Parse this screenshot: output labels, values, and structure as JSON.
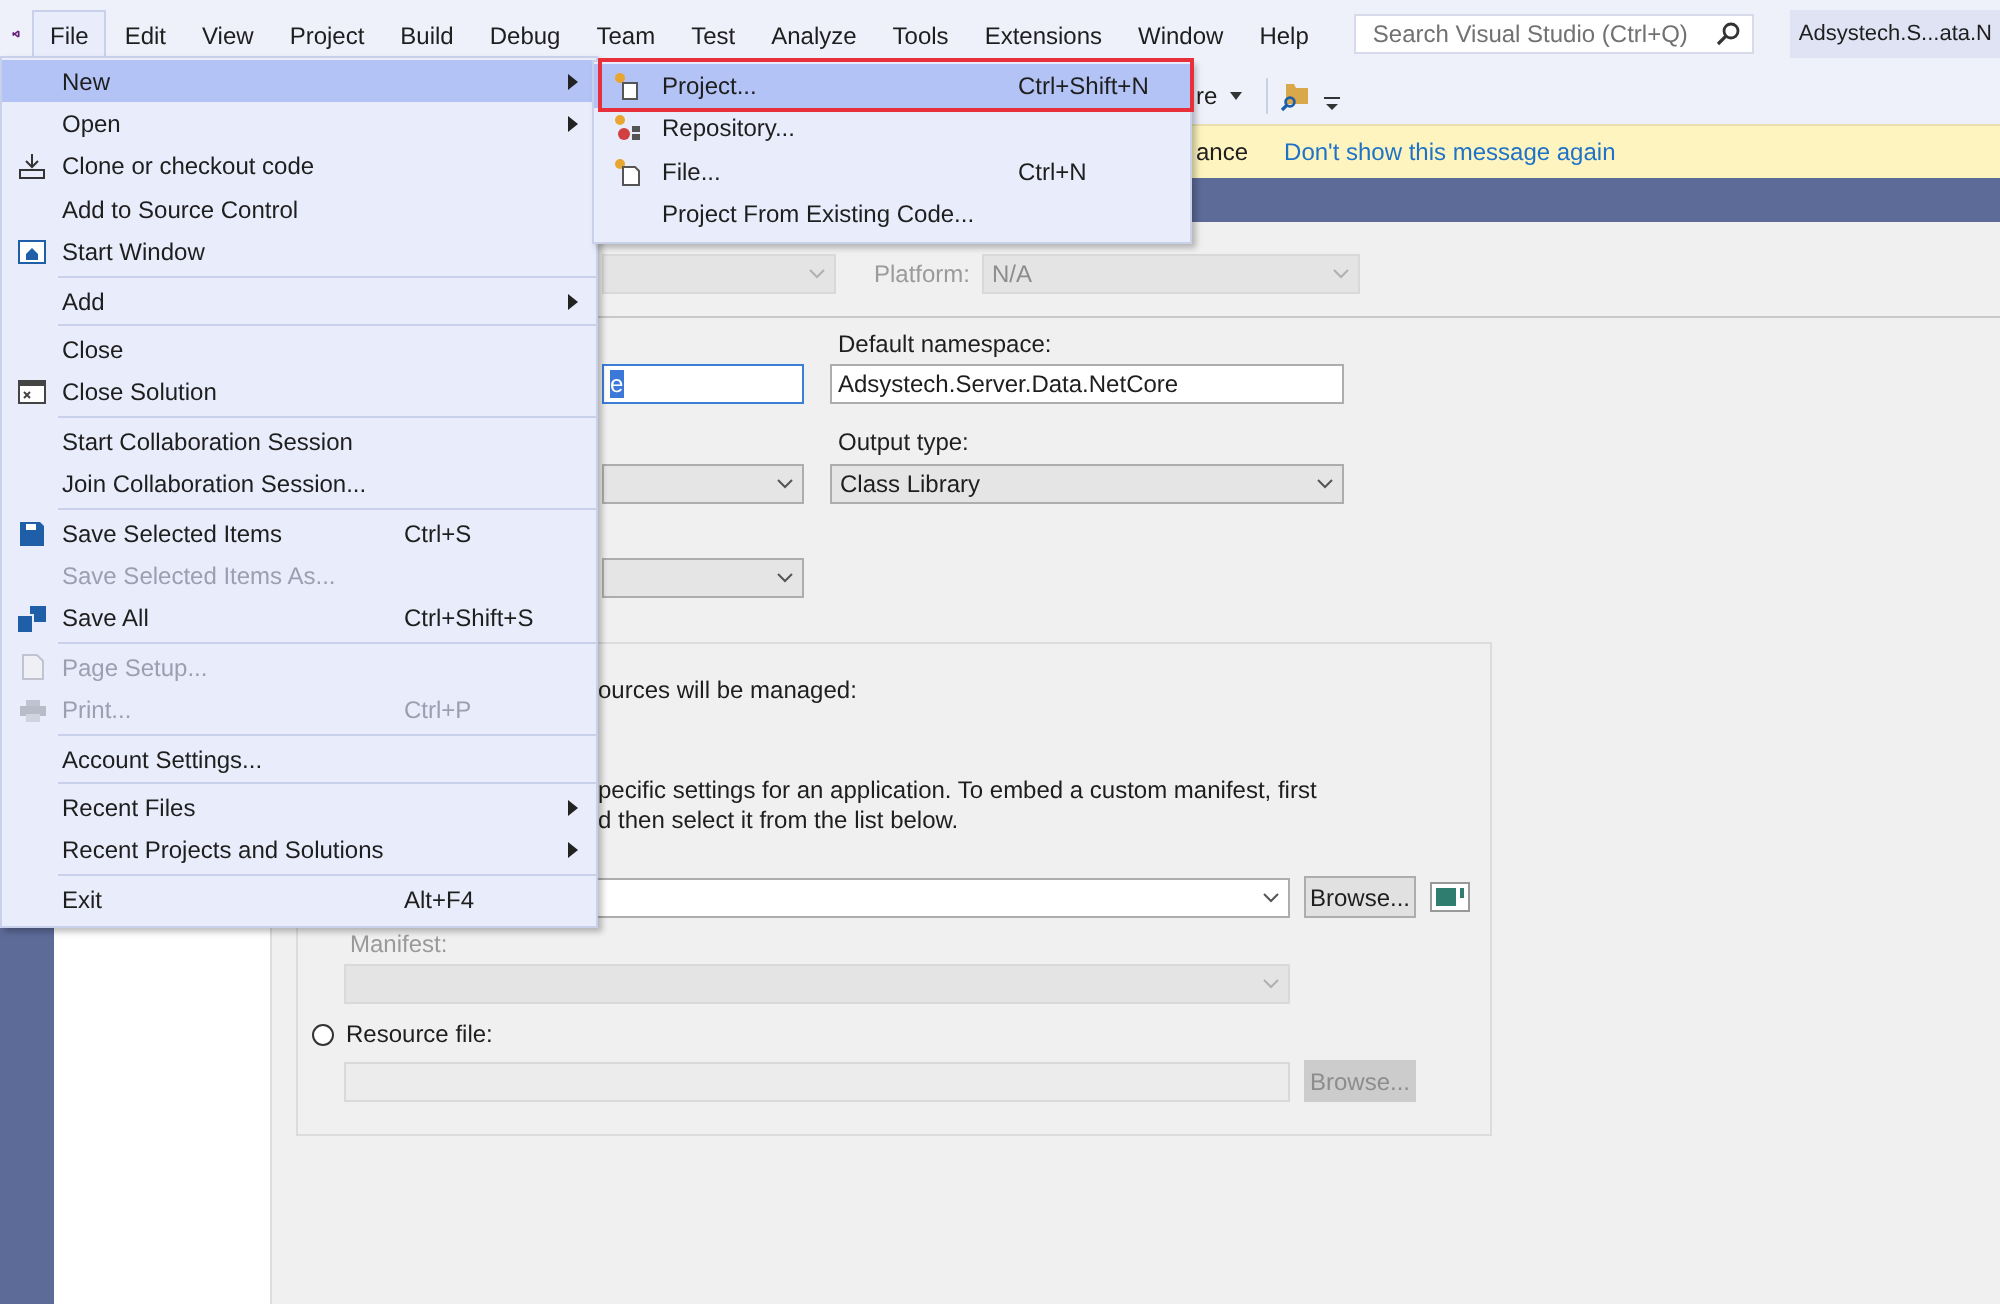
{
  "menubar": {
    "items": [
      {
        "label": "File",
        "selected": true
      },
      {
        "label": "Edit",
        "selected": false
      },
      {
        "label": "View",
        "selected": false
      },
      {
        "label": "Project",
        "selected": false
      },
      {
        "label": "Build",
        "selected": false
      },
      {
        "label": "Debug",
        "selected": false
      },
      {
        "label": "Team",
        "selected": false
      },
      {
        "label": "Test",
        "selected": false
      },
      {
        "label": "Analyze",
        "selected": false
      },
      {
        "label": "Tools",
        "selected": false
      },
      {
        "label": "Extensions",
        "selected": false
      },
      {
        "label": "Window",
        "selected": false
      },
      {
        "label": "Help",
        "selected": false
      }
    ],
    "search": {
      "placeholder": "Search Visual Studio (Ctrl+Q)"
    },
    "solution_title": "Adsystech.S...ata.N"
  },
  "toolbar": {
    "dropdown_text": "re"
  },
  "info_bar": {
    "text": "ance",
    "link": "Don't show this message again"
  },
  "properties": {
    "platform_label": "Platform:",
    "platform_value": "N/A",
    "left_input_value": "e",
    "namespace_label": "Default namespace:",
    "namespace_value": "Adsystech.Server.Data.NetCore",
    "output_label": "Output type:",
    "output_value": "Class Library",
    "resources_text": "ources will be managed:",
    "manifest_text_1": "pecific settings for an application. To embed a custom manifest, first",
    "manifest_text_2": "d then select it from the list below.",
    "browse_label": "Browse...",
    "manifest_label": "Manifest:",
    "resource_file_label": "Resource file:",
    "resource_file_selected": false,
    "resource_browse_label": "Browse..."
  },
  "file_menu": {
    "items": [
      {
        "kind": "item",
        "label": "New",
        "submenu": true,
        "selected": true,
        "disabled": false
      },
      {
        "kind": "item",
        "label": "Open",
        "submenu": true,
        "selected": false,
        "disabled": false
      },
      {
        "kind": "item",
        "label": "Clone or checkout code",
        "selected": false,
        "disabled": false
      },
      {
        "kind": "item",
        "label": "Add to Source Control",
        "selected": false,
        "disabled": false
      },
      {
        "kind": "item",
        "label": "Start Window",
        "selected": false,
        "disabled": false
      },
      {
        "kind": "separator"
      },
      {
        "kind": "item",
        "label": "Add",
        "submenu": true,
        "selected": false,
        "disabled": false
      },
      {
        "kind": "separator"
      },
      {
        "kind": "item",
        "label": "Close",
        "selected": false,
        "disabled": false
      },
      {
        "kind": "item",
        "label": "Close Solution",
        "selected": false,
        "disabled": false
      },
      {
        "kind": "separator"
      },
      {
        "kind": "item",
        "label": "Start Collaboration Session",
        "selected": false,
        "disabled": false
      },
      {
        "kind": "item",
        "label": "Join Collaboration Session...",
        "selected": false,
        "disabled": false
      },
      {
        "kind": "separator"
      },
      {
        "kind": "item",
        "label": "Save Selected Items",
        "shortcut": "Ctrl+S",
        "selected": false,
        "disabled": false
      },
      {
        "kind": "item",
        "label": "Save Selected Items As...",
        "selected": false,
        "disabled": true
      },
      {
        "kind": "item",
        "label": "Save All",
        "shortcut": "Ctrl+Shift+S",
        "selected": false,
        "disabled": false
      },
      {
        "kind": "separator"
      },
      {
        "kind": "item",
        "label": "Page Setup...",
        "selected": false,
        "disabled": true
      },
      {
        "kind": "item",
        "label": "Print...",
        "shortcut": "Ctrl+P",
        "selected": false,
        "disabled": true
      },
      {
        "kind": "separator"
      },
      {
        "kind": "item",
        "label": "Account Settings...",
        "selected": false,
        "disabled": false
      },
      {
        "kind": "separator"
      },
      {
        "kind": "item",
        "label": "Recent Files",
        "submenu": true,
        "selected": false,
        "disabled": false
      },
      {
        "kind": "item",
        "label": "Recent Projects and Solutions",
        "submenu": true,
        "selected": false,
        "disabled": false
      },
      {
        "kind": "separator"
      },
      {
        "kind": "item",
        "label": "Exit",
        "shortcut": "Alt+F4",
        "selected": false,
        "disabled": false
      }
    ]
  },
  "new_submenu": {
    "items": [
      {
        "label": "Project...",
        "shortcut": "Ctrl+Shift+N",
        "selected": true,
        "framed": true
      },
      {
        "label": "Repository...",
        "selected": false,
        "framed": false
      },
      {
        "label": "File...",
        "shortcut": "Ctrl+N",
        "selected": false,
        "framed": false
      },
      {
        "label": "Project From Existing Code...",
        "selected": false,
        "framed": false
      }
    ]
  }
}
